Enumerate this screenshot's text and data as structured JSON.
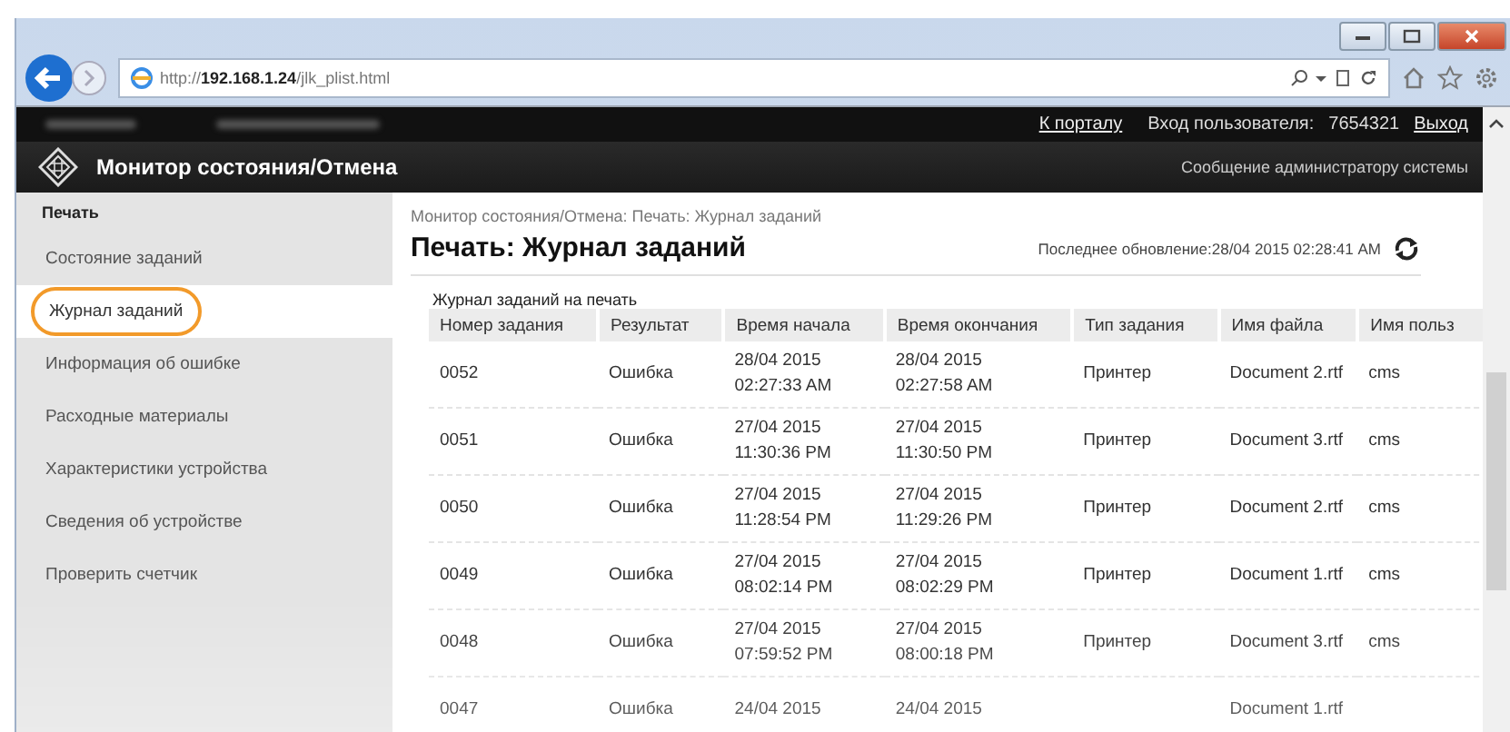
{
  "browser": {
    "url_prefix": "http://",
    "url_host": "192.168.1.24",
    "url_path": "/jlk_plist.html"
  },
  "header": {
    "links": [
      {
        "label": "К порталу"
      }
    ],
    "login_label": "Вход пользователя:",
    "login_id": "7654321",
    "logout": "Выход",
    "title": "Монитор состояния/Отмена",
    "admin_link": "Сообщение администратору системы"
  },
  "sidebar": {
    "heading": "Печать",
    "items": [
      {
        "label": "Состояние заданий",
        "selected": false,
        "highlighted": false
      },
      {
        "label": "Журнал заданий",
        "selected": true,
        "highlighted": true
      },
      {
        "label": "Информация об ошибке",
        "selected": false,
        "highlighted": false
      },
      {
        "label": "Расходные материалы",
        "selected": false,
        "highlighted": false
      },
      {
        "label": "Характеристики устройства",
        "selected": false,
        "highlighted": false
      },
      {
        "label": "Сведения об устройстве",
        "selected": false,
        "highlighted": false
      },
      {
        "label": "Проверить счетчик",
        "selected": false,
        "highlighted": false
      }
    ]
  },
  "main": {
    "breadcrumb": "Монитор состояния/Отмена: Печать: Журнал заданий",
    "title": "Печать: Журнал заданий",
    "last_update": "Последнее обновление:28/04 2015 02:28:41 AM",
    "table": {
      "caption": "Журнал заданий на печать",
      "columns": [
        "Номер задания",
        "Результат",
        "Время начала",
        "Время окончания",
        "Тип задания",
        "Имя файла",
        "Имя польз"
      ],
      "rows": [
        {
          "number": "0052",
          "result": "Ошибка",
          "start_date": "28/04 2015",
          "start_time": "02:27:33 AM",
          "end_date": "28/04 2015",
          "end_time": "02:27:58 AM",
          "type": "Принтер",
          "file": "Document 2.rtf",
          "user": "cms"
        },
        {
          "number": "0051",
          "result": "Ошибка",
          "start_date": "27/04 2015",
          "start_time": "11:30:36 PM",
          "end_date": "27/04 2015",
          "end_time": "11:30:50 PM",
          "type": "Принтер",
          "file": "Document 3.rtf",
          "user": "cms"
        },
        {
          "number": "0050",
          "result": "Ошибка",
          "start_date": "27/04 2015",
          "start_time": "11:28:54 PM",
          "end_date": "27/04 2015",
          "end_time": "11:29:26 PM",
          "type": "Принтер",
          "file": "Document 2.rtf",
          "user": "cms"
        },
        {
          "number": "0049",
          "result": "Ошибка",
          "start_date": "27/04 2015",
          "start_time": "08:02:14 PM",
          "end_date": "27/04 2015",
          "end_time": "08:02:29 PM",
          "type": "Принтер",
          "file": "Document 1.rtf",
          "user": "cms"
        },
        {
          "number": "0048",
          "result": "Ошибка",
          "start_date": "27/04 2015",
          "start_time": "07:59:52 PM",
          "end_date": "27/04 2015",
          "end_time": "08:00:18 PM",
          "type": "Принтер",
          "file": "Document 3.rtf",
          "user": "cms"
        },
        {
          "number": "0047",
          "result": "Ошибка",
          "start_date": "24/04 2015",
          "end_date": "24/04 2015",
          "file": "Document 1.rtf"
        }
      ]
    }
  }
}
